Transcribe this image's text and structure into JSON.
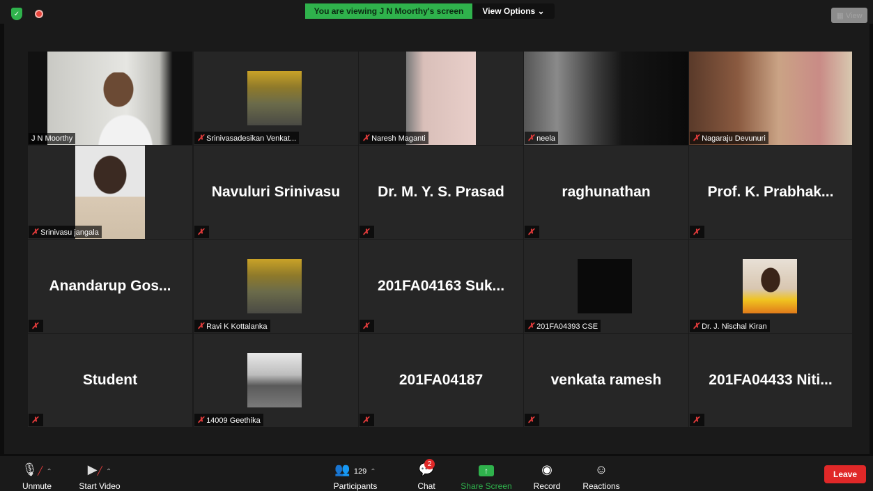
{
  "banner": {
    "viewing_text": "You are viewing J N Moorthy's screen",
    "view_options": "View Options ⌄",
    "view_label": "▦ View"
  },
  "tiles": [
    {
      "name": "J N Moorthy",
      "type": "video"
    },
    {
      "name": "Srinivasadesikan Venkat...",
      "type": "photo"
    },
    {
      "name": "Naresh Maganti",
      "type": "video"
    },
    {
      "name": "neela",
      "type": "video"
    },
    {
      "name": "Nagaraju Devunuri",
      "type": "video"
    },
    {
      "name": "Srinivasu jangala",
      "type": "video"
    },
    {
      "big": "Navuluri Srinivasu"
    },
    {
      "big": "Dr. M. Y. S. Prasad"
    },
    {
      "big": "raghunathan"
    },
    {
      "big": "Prof.  K.  Prabhak..."
    },
    {
      "big": "Anandarup  Gos..."
    },
    {
      "name": "Ravi K Kottalanka",
      "type": "photo"
    },
    {
      "big": "201FA04163  Suk..."
    },
    {
      "name": "201FA04393 CSE",
      "type": "photo"
    },
    {
      "name": "Dr. J. Nischal Kiran",
      "type": "photo"
    },
    {
      "big": "Student"
    },
    {
      "name": "14009 Geethika",
      "type": "photo"
    },
    {
      "big": "201FA04187"
    },
    {
      "big": "venkata ramesh"
    },
    {
      "big": "201FA04433  Niti..."
    }
  ],
  "toolbar": {
    "unmute": "Unmute",
    "start_video": "Start Video",
    "participants": "Participants",
    "participants_count": "129",
    "chat": "Chat",
    "chat_badge": "2",
    "share_screen": "Share Screen",
    "record": "Record",
    "reactions": "Reactions",
    "leave": "Leave"
  },
  "colors": {
    "share_green": "#2fb24c",
    "leave_red": "#e02828",
    "active_speaker": "#e4e47a"
  }
}
